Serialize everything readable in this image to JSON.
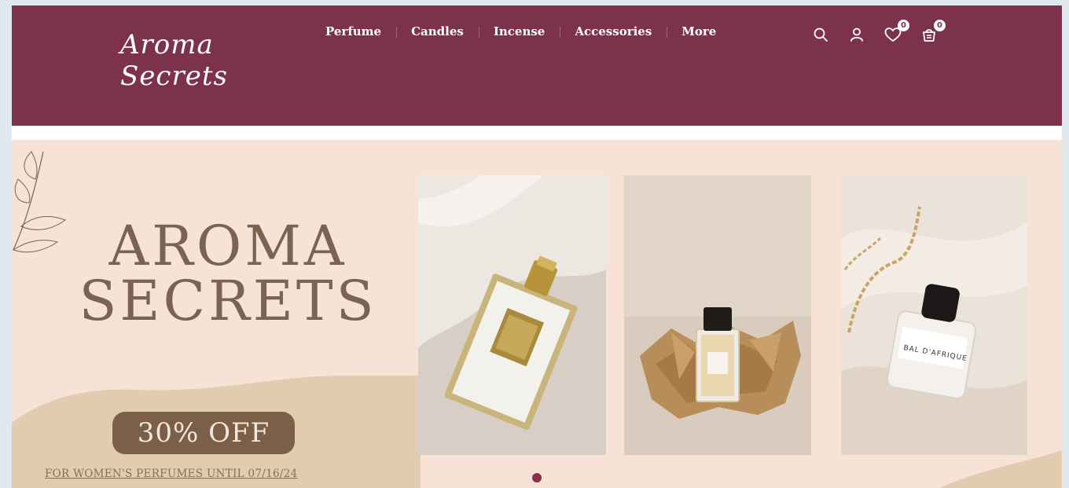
{
  "header": {
    "logo_line1": "Aroma",
    "logo_line2": "Secrets",
    "nav": [
      "Perfume",
      "Candles",
      "Incense",
      "Accessories",
      "More"
    ],
    "icons": [
      "search-icon",
      "user-icon",
      "heart-icon",
      "cart-icon"
    ],
    "wishlist_count": "0",
    "cart_count": "0"
  },
  "hero": {
    "title_line1": "AROMA",
    "title_line2": "SECRETS",
    "offer": "30% OFF",
    "offer_note": "FOR WOMEN'S PERFUMES UNTIL 07/16/24",
    "bottle_label_2": "BAL D'AFRIQUE",
    "slide_indicator": {
      "total": 1,
      "active": 1
    }
  },
  "colors": {
    "brand": "#7d324b",
    "hero_bg": "#f6e3d6",
    "accent_brown": "#7b5f49"
  }
}
